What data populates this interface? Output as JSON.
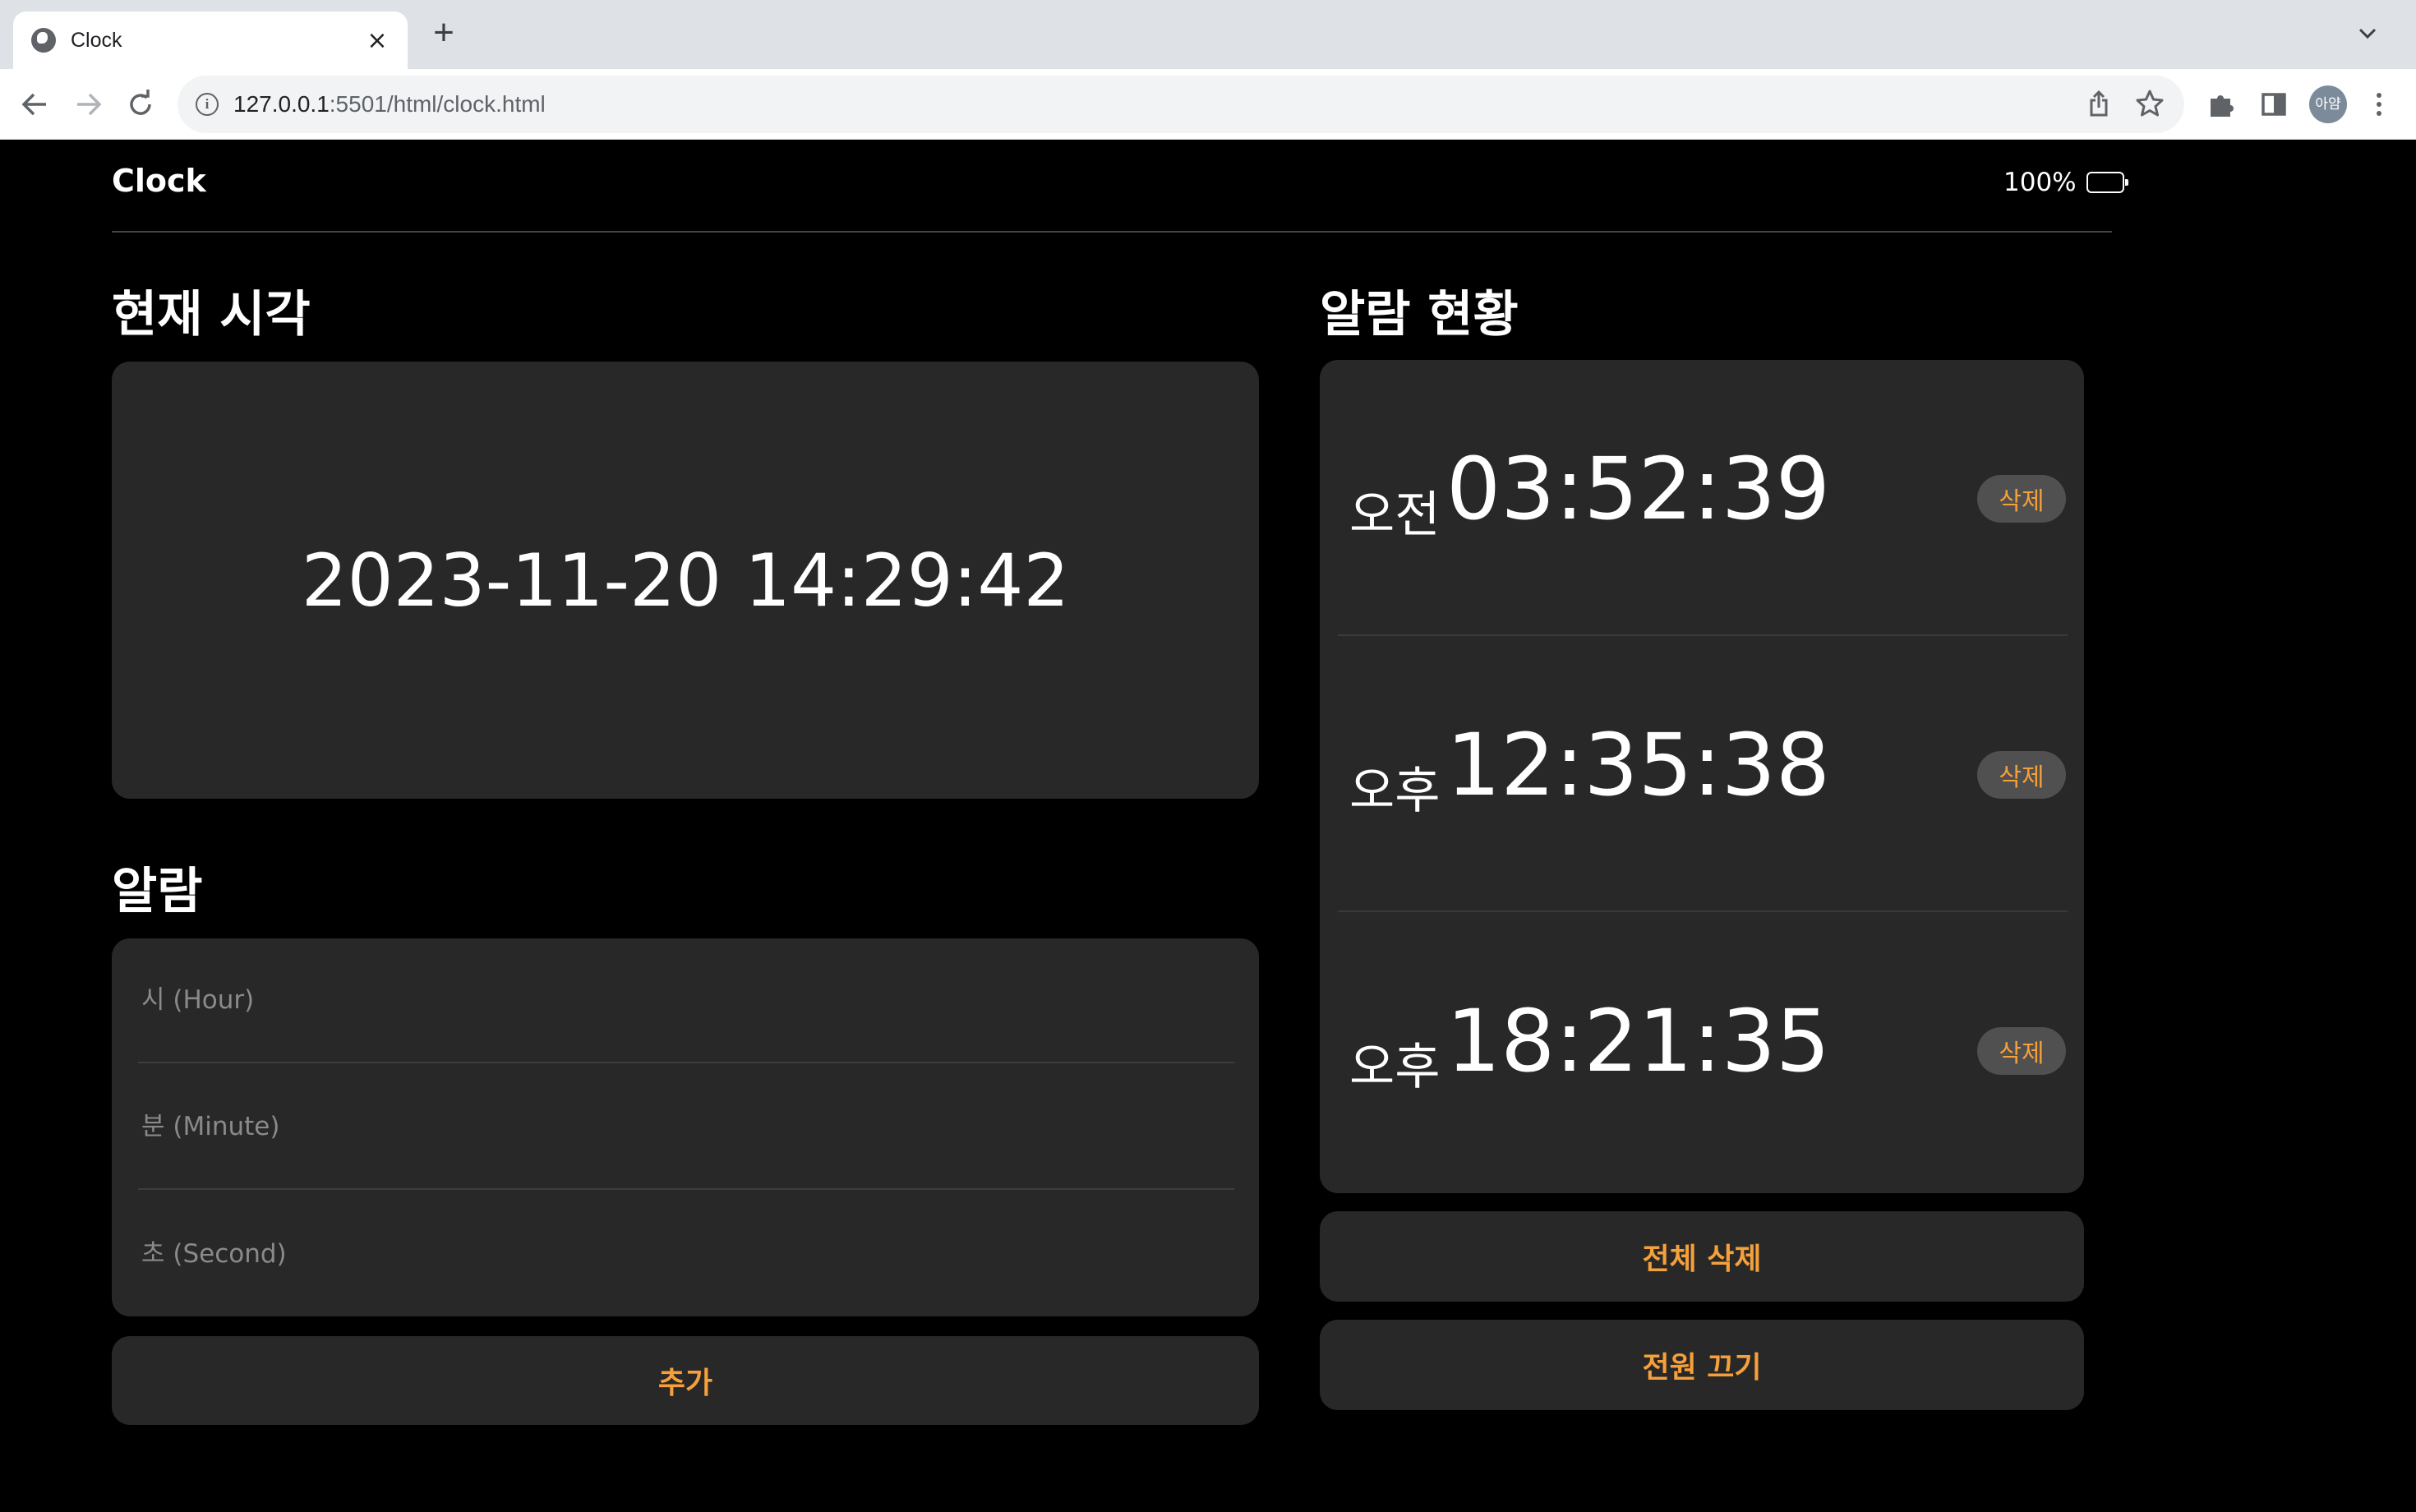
{
  "browser": {
    "tab_title": "Clock",
    "tab_close": "×",
    "new_tab": "+",
    "url_host": "127.0.0.1",
    "url_rest": ":5501/html/clock.html",
    "avatar_text": "아얌"
  },
  "header": {
    "app_title": "Clock",
    "battery_percent": "100%",
    "battery_level": 1.0
  },
  "current_time": {
    "heading": "현재 시각",
    "value": "2023-11-20 14:29:42"
  },
  "alarm_form": {
    "heading": "알람",
    "hour_placeholder": "시 (Hour)",
    "minute_placeholder": "분 (Minute)",
    "second_placeholder": "초 (Second)",
    "add_label": "추가"
  },
  "alarm_list": {
    "heading": "알람 현황",
    "items": [
      {
        "period": "오전",
        "time": "03:52:39",
        "delete_label": "삭제"
      },
      {
        "period": "오후",
        "time": "12:35:38",
        "delete_label": "삭제"
      },
      {
        "period": "오후",
        "time": "18:21:35",
        "delete_label": "삭제"
      }
    ],
    "delete_all_label": "전체 삭제",
    "power_off_label": "전원 끄기"
  },
  "colors": {
    "accent": "#f5a03a",
    "card": "#282828",
    "background": "#000000"
  }
}
